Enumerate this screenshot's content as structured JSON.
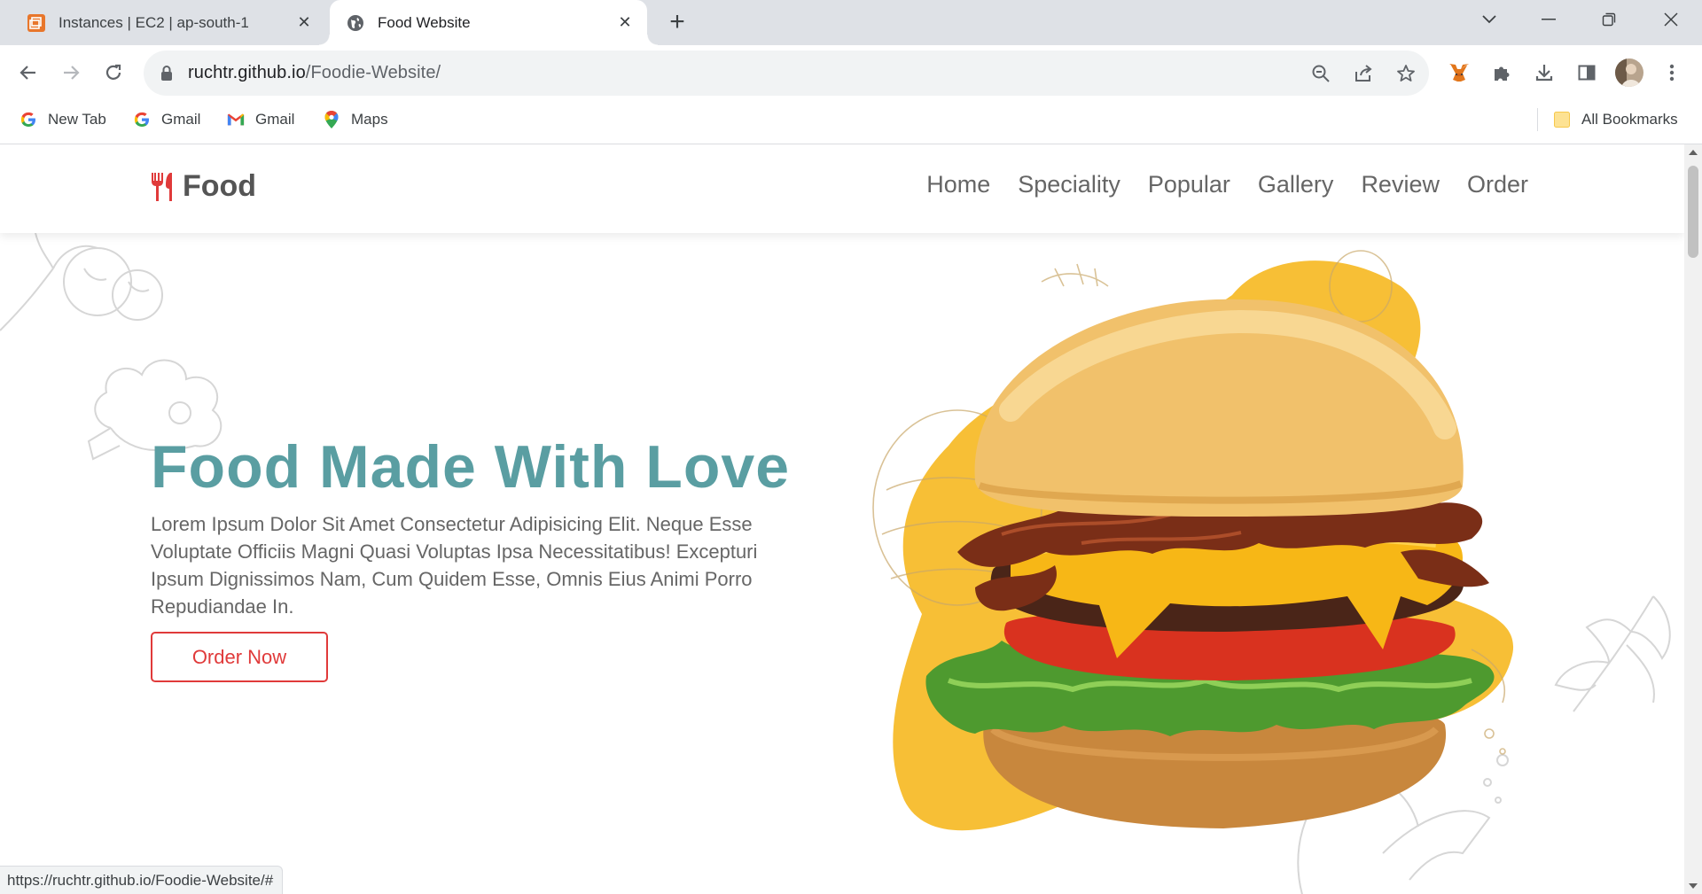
{
  "browser": {
    "tabs": [
      {
        "title": "Instances | EC2 | ap-south-1",
        "active": false,
        "icon": "aws-ec2-icon"
      },
      {
        "title": "Food Website",
        "active": true,
        "icon": "globe-icon"
      }
    ],
    "url": {
      "host": "ruchtr.github.io",
      "path": "/Foodie-Website/"
    },
    "bookmarks": [
      {
        "label": "New Tab",
        "icon": "google-icon"
      },
      {
        "label": "Gmail",
        "icon": "google-icon"
      },
      {
        "label": "Gmail",
        "icon": "gmail-icon"
      },
      {
        "label": "Maps",
        "icon": "maps-icon"
      }
    ],
    "all_bookmarks_label": "All Bookmarks",
    "status_url": "https://ruchtr.github.io/Foodie-Website/#"
  },
  "site": {
    "logo_text": "Food",
    "nav": [
      "Home",
      "Speciality",
      "Popular",
      "Gallery",
      "Review",
      "Order"
    ],
    "hero": {
      "title": "Food Made With Love",
      "description": "Lorem Ipsum Dolor Sit Amet Consectetur Adipisicing Elit. Neque Esse Voluptate Officiis Magni Quasi Voluptas Ipsa Necessitatibus! Excepturi Ipsum Dignissimos Nam, Cum Quidem Esse, Omnis Eius Animi Porro Repudiandae In.",
      "cta": "Order Now"
    }
  },
  "colors": {
    "accent_teal": "#5a9ea2",
    "cta_red": "#e03a3a",
    "blob_yellow": "#f7bf36"
  }
}
